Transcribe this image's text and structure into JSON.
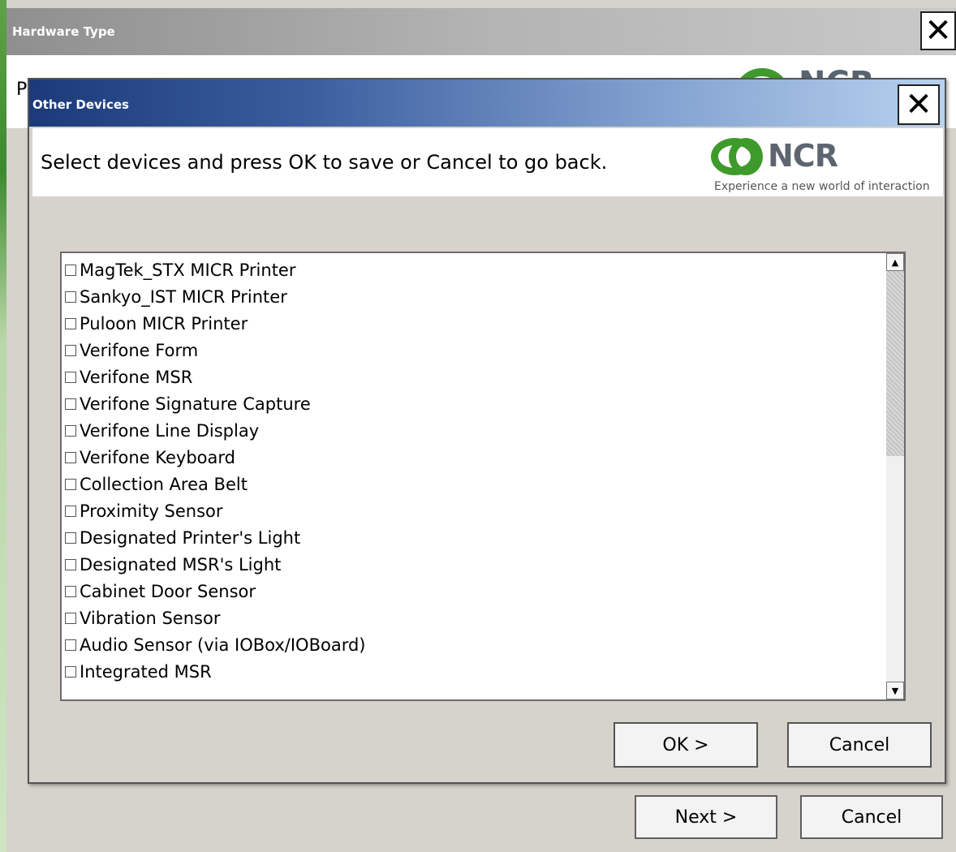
{
  "back_window": {
    "title": "Hardware Type",
    "close_glyph": "✕",
    "partial_text": "P",
    "logo_partial": "NCR",
    "next_label": "Next >",
    "cancel_label": "Cancel"
  },
  "dialog": {
    "title": "Other Devices",
    "close_glyph": "✕",
    "instruction": "Select devices and press OK to save or Cancel to go back.",
    "logo": {
      "wordmark": "NCR",
      "tagline": "Experience a new world of interaction",
      "color": "#3e9a2a"
    },
    "devices": [
      "MagTek_STX MICR Printer",
      "Sankyo_IST MICR Printer",
      "Puloon MICR Printer",
      "Verifone Form",
      "Verifone MSR",
      "Verifone Signature Capture",
      "Verifone Line Display",
      "Verifone Keyboard",
      "Collection Area Belt",
      "Proximity Sensor",
      "Designated Printer's Light",
      "Designated MSR's Light",
      "Cabinet Door Sensor",
      "Vibration Sensor",
      "Audio Sensor (via IOBox/IOBoard)",
      "Integrated MSR"
    ],
    "scroll_up": "▲",
    "scroll_down": "▼",
    "ok_label": "OK >",
    "cancel_label": "Cancel"
  }
}
